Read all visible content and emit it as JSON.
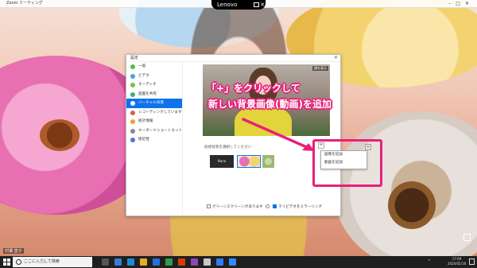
{
  "window": {
    "title": "Zoom ミーティング"
  },
  "lenovo": {
    "brand": "Lenovo"
  },
  "corner_label": "村瀬 直子",
  "dialog": {
    "title": "設定",
    "sidebar": [
      {
        "label": "一般",
        "color": "#58b84a"
      },
      {
        "label": "ビデオ",
        "color": "#4aa3df"
      },
      {
        "label": "オーディオ",
        "color": "#7cc242"
      },
      {
        "label": "画面を共有",
        "color": "#38b27b"
      },
      {
        "label": "バーチャル背景",
        "color": "#0e72ed",
        "active": true
      },
      {
        "label": "レコーディングしています",
        "color": "#e55a4f"
      },
      {
        "label": "統計情報",
        "color": "#f0a030"
      },
      {
        "label": "キーボードショートカット",
        "color": "#8a8a8a"
      },
      {
        "label": "接近性",
        "color": "#4a7bd0"
      }
    ],
    "preview_badge": "顔を表示",
    "bg_select_label": "仮想背景を選択してください",
    "thumb_none": "None",
    "checkbox_green": "グリーンスクリーンがあります",
    "checkbox_mirror": "マイビデオをミラーリング",
    "add_menu": [
      "画像を追加",
      "動画を追加"
    ]
  },
  "annotation": {
    "line1": "「+」をクリックして",
    "line2": "新しい背景画像(動画)を追加",
    "color": "#e8207a"
  },
  "taskbar": {
    "search_placeholder": "ここに入力して検索",
    "time": "17:09",
    "date": "2020/05/18",
    "icons": [
      "#555",
      "#3a7bd5",
      "#1e8ad6",
      "#e9a825",
      "#2a6fd4",
      "#2d9d4c",
      "#d83b01",
      "#9146b3",
      "#c8c8c8",
      "#2e7df6",
      "#2d8cff"
    ]
  }
}
